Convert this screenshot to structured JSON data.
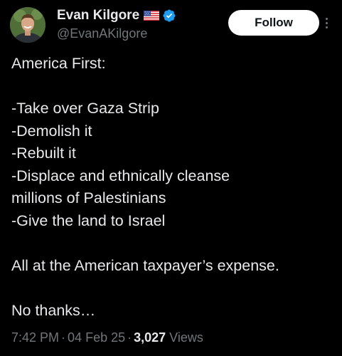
{
  "author": {
    "display_name": "Evan Kilgore",
    "handle": "@EvanAKilgore",
    "flag_icon": "us-flag-icon",
    "verified_icon": "verified-badge-icon",
    "verified_color": "#1d9bf0"
  },
  "follow_button": {
    "label": "Follow"
  },
  "more_menu": {
    "icon": "more-vertical-icon"
  },
  "post": {
    "lines": [
      "America First:",
      "",
      "-Take over Gaza Strip",
      "-Demolish it",
      "-Rebuilt it",
      "-Displace and ethnically cleanse",
      "millions of Palestinians",
      "-Give the land to Israel",
      "",
      "All at the American taxpayer’s expense.",
      "",
      "No thanks…"
    ]
  },
  "meta": {
    "time": "7:42 PM",
    "separator": "·",
    "date": "04 Feb 25",
    "views_count": "3,027",
    "views_label": "Views"
  },
  "colors": {
    "background": "#000000",
    "text": "#e7e9ea",
    "secondary": "#71767b",
    "follow_bg": "#ffffff",
    "follow_text": "#0f1419"
  }
}
